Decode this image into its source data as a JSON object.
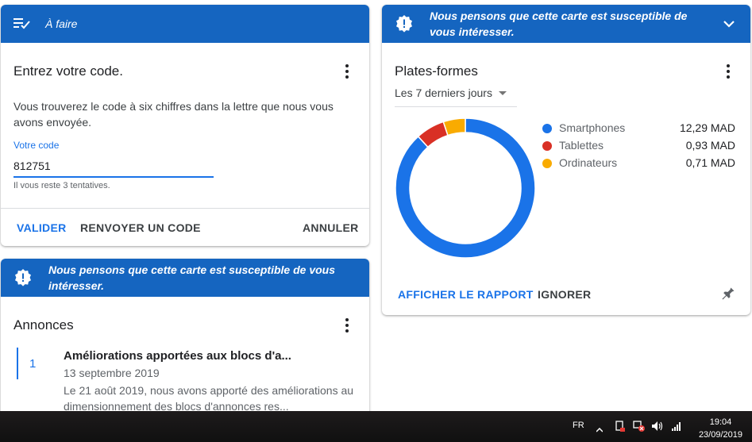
{
  "colors": {
    "header_bg": "#1565c0",
    "accent": "#1a73e8"
  },
  "todo_card": {
    "header_title": "À faire",
    "header_icon": "playlist-check-icon",
    "title": "Entrez votre code.",
    "description": "Vous trouverez le code à six chiffres dans la lettre que nous vous avons envoyée.",
    "field_label": "Votre code",
    "field_value": "812751",
    "hint": "Il vous reste 3 tentatives.",
    "validate": "VALIDER",
    "resend": "RENVOYER UN CODE",
    "cancel": "ANNULER"
  },
  "announcements_card": {
    "header_title": "Nous pensons que cette carte est susceptible de vous intéresser.",
    "header_icon": "badge-alert-icon",
    "title": "Annonces",
    "item": {
      "number": "1",
      "title": "Améliorations apportées aux blocs d'a...",
      "date": "13 septembre 2019",
      "body": "Le 21 août 2019, nous avons apporté des améliorations au dimensionnement des blocs d'annonces res..."
    }
  },
  "platforms_card": {
    "header_title": "Nous pensons que cette carte est susceptible de vous intéresser.",
    "header_icon": "badge-alert-icon",
    "expand_icon": "chevron-down-icon",
    "title": "Plates-formes",
    "period": "Les 7 derniers jours",
    "view_report": "AFFICHER LE RAPPORT",
    "ignore": "IGNORER",
    "pin_icon": "pin-icon"
  },
  "chart_data": {
    "type": "pie",
    "donut": true,
    "series": [
      {
        "name": "Smartphones",
        "value": 12.29,
        "label": "12,29 MAD",
        "color": "#1a73e8"
      },
      {
        "name": "Tablettes",
        "value": 0.93,
        "label": "0,93 MAD",
        "color": "#d93025"
      },
      {
        "name": "Ordinateurs",
        "value": 0.71,
        "label": "0,71 MAD",
        "color": "#f9ab00"
      }
    ]
  },
  "taskbar": {
    "language": "FR",
    "time": "19:04",
    "date": "23/09/2019",
    "tray_icons": [
      "chevron-up-icon",
      "power-icon",
      "network-flag-icon",
      "volume-icon",
      "signal-icon"
    ]
  }
}
